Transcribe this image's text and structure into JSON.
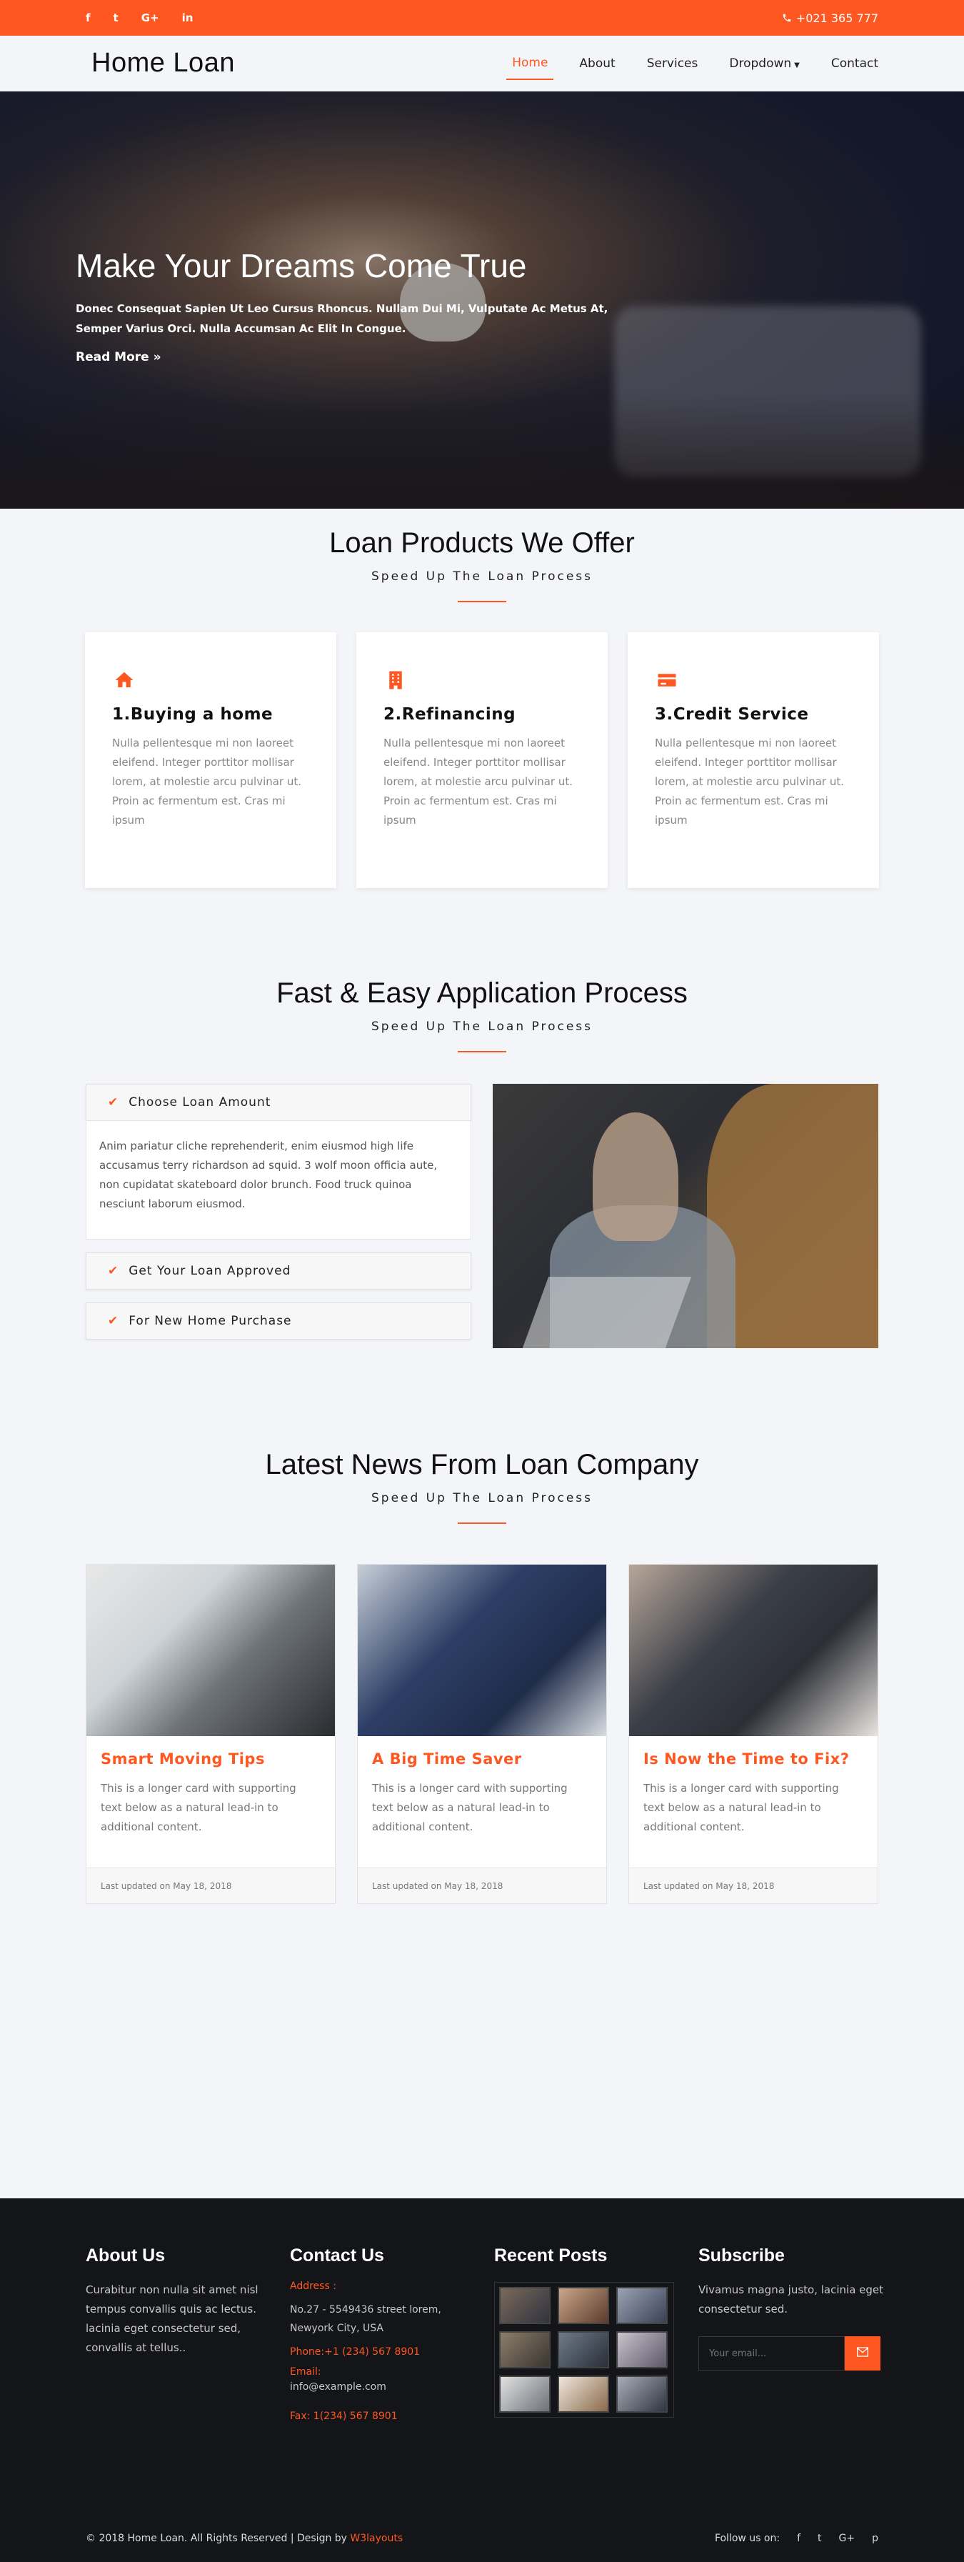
{
  "topbar": {
    "social": [
      "f",
      "t",
      "G+",
      "in"
    ],
    "phone": "+021 365 777",
    "phone_icon": "phone-icon"
  },
  "header": {
    "logo": "Home Loan",
    "nav": [
      {
        "label": "Home",
        "active": true
      },
      {
        "label": "About"
      },
      {
        "label": "Services"
      },
      {
        "label": "Dropdown"
      },
      {
        "label": "Contact"
      }
    ]
  },
  "hero": {
    "title": "Make Your Dreams Come True",
    "text": "Donec Consequat Sapien Ut Leo Cursus Rhoncus. Nullam Dui Mi, Vulputate Ac Metus At, Semper Varius Orci. Nulla Accumsan Ac Elit In Congue.",
    "link": "Read More »"
  },
  "products": {
    "title": "Loan Products We Offer",
    "subtitle": "Speed Up The Loan Process",
    "cards": [
      {
        "title": "1.Buying a home",
        "icon": "home-icon",
        "text": "Nulla pellentesque mi non laoreet eleifend. Integer porttitor mollisar lorem, at molestie arcu pulvinar ut. Proin ac fermentum est. Cras mi ipsum"
      },
      {
        "title": "2.Refinancing",
        "icon": "building-icon",
        "text": "Nulla pellentesque mi non laoreet eleifend. Integer porttitor mollisar lorem, at molestie arcu pulvinar ut. Proin ac fermentum est. Cras mi ipsum"
      },
      {
        "title": "3.Credit Service",
        "icon": "credit-card-icon",
        "text": "Nulla pellentesque mi non laoreet eleifend. Integer porttitor mollisar lorem, at molestie arcu pulvinar ut. Proin ac fermentum est. Cras mi ipsum"
      }
    ]
  },
  "process": {
    "title": "Fast & Easy Application Process",
    "subtitle": "Speed Up The Loan Process",
    "items": [
      {
        "label": "Choose Loan Amount",
        "body": "Anim pariatur cliche reprehenderit, enim eiusmod high life accusamus terry richardson ad squid. 3 wolf moon officia aute, non cupidatat skateboard dolor brunch. Food truck quinoa nesciunt laborum eiusmod."
      },
      {
        "label": "Get Your Loan Approved"
      },
      {
        "label": "For New Home Purchase"
      }
    ]
  },
  "news": {
    "title": "Latest News From Loan Company",
    "subtitle": "Speed Up The Loan Process",
    "cards": [
      {
        "title": "Smart Moving Tips",
        "text": "This is a longer card with supporting text below as a natural lead-in to additional content.",
        "footer": "Last updated on May 18, 2018"
      },
      {
        "title": "A Big Time Saver",
        "text": "This is a longer card with supporting text below as a natural lead-in to additional content.",
        "footer": "Last updated on May 18, 2018"
      },
      {
        "title": "Is Now the Time to Fix?",
        "text": "This is a longer card with supporting text below as a natural lead-in to additional content.",
        "footer": "Last updated on May 18, 2018"
      }
    ]
  },
  "footer": {
    "about": {
      "title": "About Us",
      "text": "Curabitur non nulla sit amet nisl tempus convallis quis ac lectus. lacinia eget consectetur sed, convallis at tellus.."
    },
    "contact": {
      "title": "Contact Us",
      "address_label": "Address :",
      "address": "No.27 - 5549436 street lorem, Newyork City, USA",
      "phone": "Phone:+1 (234) 567 8901",
      "email_label": "Email:",
      "email": "info@example.com",
      "fax": "Fax: 1(234) 567 8901"
    },
    "posts": {
      "title": "Recent Posts"
    },
    "subscribe": {
      "title": "Subscribe",
      "text": "Vivamus magna justo, lacinia eget consectetur sed.",
      "placeholder": "Your email..."
    },
    "copyright": "© 2018 Home Loan. All Rights Reserved | Design by",
    "designer": "W3layouts",
    "follow": "Follow us on:",
    "follow_icons": [
      "f",
      "t",
      "G+",
      "p"
    ]
  }
}
